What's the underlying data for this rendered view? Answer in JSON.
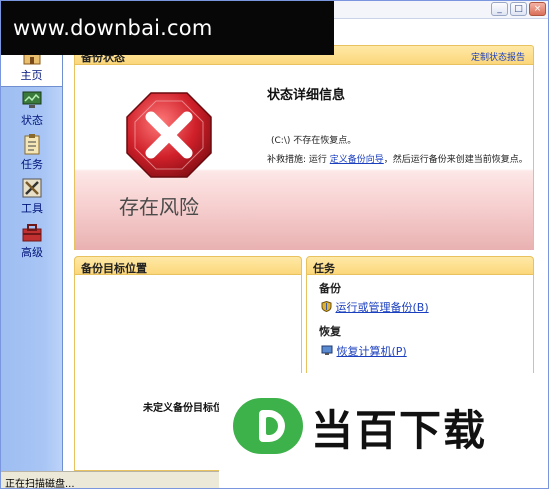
{
  "watermark": {
    "top_text": "www.downbai.com",
    "logo_text": "当百下载",
    "logo_letter": "D"
  },
  "window": {
    "controls": [
      "_",
      "□",
      "×"
    ]
  },
  "sidebar": {
    "items": [
      {
        "label": "主页",
        "icon": "home-icon"
      },
      {
        "label": "状态",
        "icon": "monitor-icon"
      },
      {
        "label": "任务",
        "icon": "clipboard-icon"
      },
      {
        "label": "工具",
        "icon": "tools-icon"
      },
      {
        "label": "高级",
        "icon": "toolbox-icon"
      }
    ]
  },
  "status_panel": {
    "header_title": "备份状态",
    "header_link": "定制状态报告",
    "risk_label": "存在风险",
    "detail_title": "状态详细信息",
    "detail_line1": "(C:\\) 不存在恢复点。",
    "remedy_prefix": "补救措施: 运行 ",
    "remedy_link": "定义备份向导",
    "remedy_suffix": "，然后运行备份来创建当前恢复点。"
  },
  "backup_target": {
    "header": "备份目标位置",
    "empty_note": "未定义备份目标位"
  },
  "tasks": {
    "header": "任务",
    "group_backup": "备份",
    "run_backup": "运行或管理备份",
    "run_backup_key": "(B)",
    "group_restore": "恢复",
    "restore_computer": "恢复计算机",
    "restore_key": "(P)"
  },
  "statusbar": {
    "text": "正在扫描磁盘..."
  },
  "colors": {
    "accent_link": "#1b3fbf",
    "panel_header": "#fbd77b",
    "risk_red": "#d0202a",
    "sidebar": "#a8c5f5"
  }
}
